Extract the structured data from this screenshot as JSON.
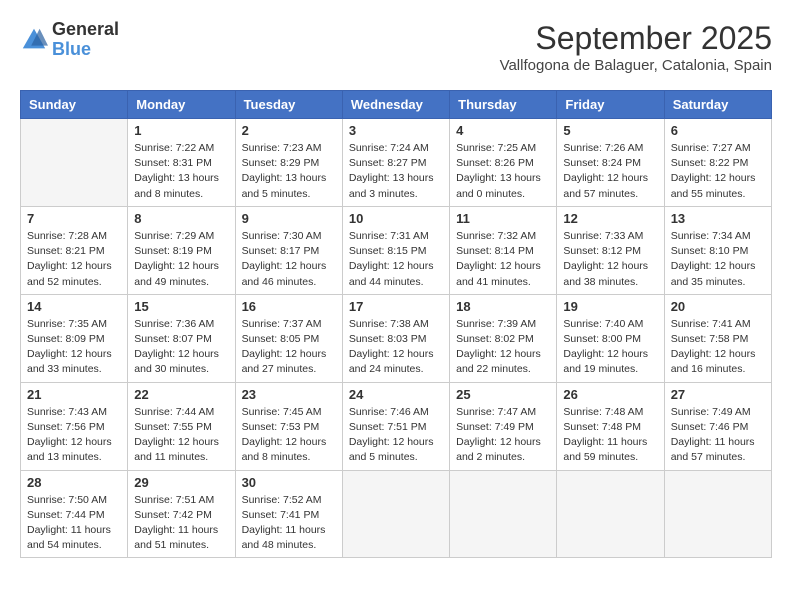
{
  "header": {
    "logo": {
      "line1": "General",
      "line2": "Blue"
    },
    "title": "September 2025",
    "location": "Vallfogona de Balaguer, Catalonia, Spain"
  },
  "weekdays": [
    "Sunday",
    "Monday",
    "Tuesday",
    "Wednesday",
    "Thursday",
    "Friday",
    "Saturday"
  ],
  "weeks": [
    [
      {
        "day": "",
        "info": ""
      },
      {
        "day": "1",
        "info": "Sunrise: 7:22 AM\nSunset: 8:31 PM\nDaylight: 13 hours\nand 8 minutes."
      },
      {
        "day": "2",
        "info": "Sunrise: 7:23 AM\nSunset: 8:29 PM\nDaylight: 13 hours\nand 5 minutes."
      },
      {
        "day": "3",
        "info": "Sunrise: 7:24 AM\nSunset: 8:27 PM\nDaylight: 13 hours\nand 3 minutes."
      },
      {
        "day": "4",
        "info": "Sunrise: 7:25 AM\nSunset: 8:26 PM\nDaylight: 13 hours\nand 0 minutes."
      },
      {
        "day": "5",
        "info": "Sunrise: 7:26 AM\nSunset: 8:24 PM\nDaylight: 12 hours\nand 57 minutes."
      },
      {
        "day": "6",
        "info": "Sunrise: 7:27 AM\nSunset: 8:22 PM\nDaylight: 12 hours\nand 55 minutes."
      }
    ],
    [
      {
        "day": "7",
        "info": "Sunrise: 7:28 AM\nSunset: 8:21 PM\nDaylight: 12 hours\nand 52 minutes."
      },
      {
        "day": "8",
        "info": "Sunrise: 7:29 AM\nSunset: 8:19 PM\nDaylight: 12 hours\nand 49 minutes."
      },
      {
        "day": "9",
        "info": "Sunrise: 7:30 AM\nSunset: 8:17 PM\nDaylight: 12 hours\nand 46 minutes."
      },
      {
        "day": "10",
        "info": "Sunrise: 7:31 AM\nSunset: 8:15 PM\nDaylight: 12 hours\nand 44 minutes."
      },
      {
        "day": "11",
        "info": "Sunrise: 7:32 AM\nSunset: 8:14 PM\nDaylight: 12 hours\nand 41 minutes."
      },
      {
        "day": "12",
        "info": "Sunrise: 7:33 AM\nSunset: 8:12 PM\nDaylight: 12 hours\nand 38 minutes."
      },
      {
        "day": "13",
        "info": "Sunrise: 7:34 AM\nSunset: 8:10 PM\nDaylight: 12 hours\nand 35 minutes."
      }
    ],
    [
      {
        "day": "14",
        "info": "Sunrise: 7:35 AM\nSunset: 8:09 PM\nDaylight: 12 hours\nand 33 minutes."
      },
      {
        "day": "15",
        "info": "Sunrise: 7:36 AM\nSunset: 8:07 PM\nDaylight: 12 hours\nand 30 minutes."
      },
      {
        "day": "16",
        "info": "Sunrise: 7:37 AM\nSunset: 8:05 PM\nDaylight: 12 hours\nand 27 minutes."
      },
      {
        "day": "17",
        "info": "Sunrise: 7:38 AM\nSunset: 8:03 PM\nDaylight: 12 hours\nand 24 minutes."
      },
      {
        "day": "18",
        "info": "Sunrise: 7:39 AM\nSunset: 8:02 PM\nDaylight: 12 hours\nand 22 minutes."
      },
      {
        "day": "19",
        "info": "Sunrise: 7:40 AM\nSunset: 8:00 PM\nDaylight: 12 hours\nand 19 minutes."
      },
      {
        "day": "20",
        "info": "Sunrise: 7:41 AM\nSunset: 7:58 PM\nDaylight: 12 hours\nand 16 minutes."
      }
    ],
    [
      {
        "day": "21",
        "info": "Sunrise: 7:43 AM\nSunset: 7:56 PM\nDaylight: 12 hours\nand 13 minutes."
      },
      {
        "day": "22",
        "info": "Sunrise: 7:44 AM\nSunset: 7:55 PM\nDaylight: 12 hours\nand 11 minutes."
      },
      {
        "day": "23",
        "info": "Sunrise: 7:45 AM\nSunset: 7:53 PM\nDaylight: 12 hours\nand 8 minutes."
      },
      {
        "day": "24",
        "info": "Sunrise: 7:46 AM\nSunset: 7:51 PM\nDaylight: 12 hours\nand 5 minutes."
      },
      {
        "day": "25",
        "info": "Sunrise: 7:47 AM\nSunset: 7:49 PM\nDaylight: 12 hours\nand 2 minutes."
      },
      {
        "day": "26",
        "info": "Sunrise: 7:48 AM\nSunset: 7:48 PM\nDaylight: 11 hours\nand 59 minutes."
      },
      {
        "day": "27",
        "info": "Sunrise: 7:49 AM\nSunset: 7:46 PM\nDaylight: 11 hours\nand 57 minutes."
      }
    ],
    [
      {
        "day": "28",
        "info": "Sunrise: 7:50 AM\nSunset: 7:44 PM\nDaylight: 11 hours\nand 54 minutes."
      },
      {
        "day": "29",
        "info": "Sunrise: 7:51 AM\nSunset: 7:42 PM\nDaylight: 11 hours\nand 51 minutes."
      },
      {
        "day": "30",
        "info": "Sunrise: 7:52 AM\nSunset: 7:41 PM\nDaylight: 11 hours\nand 48 minutes."
      },
      {
        "day": "",
        "info": ""
      },
      {
        "day": "",
        "info": ""
      },
      {
        "day": "",
        "info": ""
      },
      {
        "day": "",
        "info": ""
      }
    ]
  ]
}
